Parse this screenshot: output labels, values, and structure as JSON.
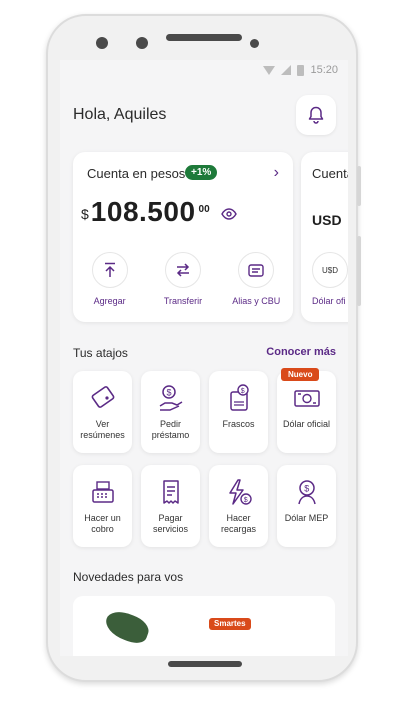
{
  "status_bar": {
    "time": "15:20"
  },
  "header": {
    "greeting": "Hola, Aquiles"
  },
  "account_card": {
    "title": "Cuenta en pesos",
    "badge": "+1%",
    "currency_symbol": "$",
    "amount": "108.500",
    "cents": "00",
    "actions": [
      {
        "label": "Agregar",
        "icon": "upload-arrow-icon"
      },
      {
        "label": "Transferir",
        "icon": "transfer-arrows-icon"
      },
      {
        "label": "Alias y CBU",
        "icon": "id-card-icon"
      }
    ]
  },
  "usd_card": {
    "title": "Cuenta",
    "currency": "USD",
    "action_icon_text": "U$D",
    "action_label": "Dólar ofi"
  },
  "shortcuts": {
    "title": "Tus atajos",
    "more_link": "Conocer más",
    "items": [
      {
        "label": "Ver resúmenes",
        "icon": "statement-icon"
      },
      {
        "label": "Pedir préstamo",
        "icon": "loan-hand-icon"
      },
      {
        "label": "Frascos",
        "icon": "jar-icon"
      },
      {
        "label": "Dólar oficial",
        "icon": "banknote-icon",
        "tag": "Nuevo"
      },
      {
        "label": "Hacer un cobro",
        "icon": "cash-register-icon"
      },
      {
        "label": "Pagar servicios",
        "icon": "bill-icon"
      },
      {
        "label": "Hacer recargas",
        "icon": "lightning-icon"
      },
      {
        "label": "Dólar MEP",
        "icon": "dollar-person-icon"
      }
    ]
  },
  "news": {
    "title": "Novedades para vos",
    "promo_tag": "Smartes"
  },
  "colors": {
    "accent": "#5b2a86",
    "badge_green": "#1e7a3a",
    "tag_orange": "#d94a1a"
  }
}
